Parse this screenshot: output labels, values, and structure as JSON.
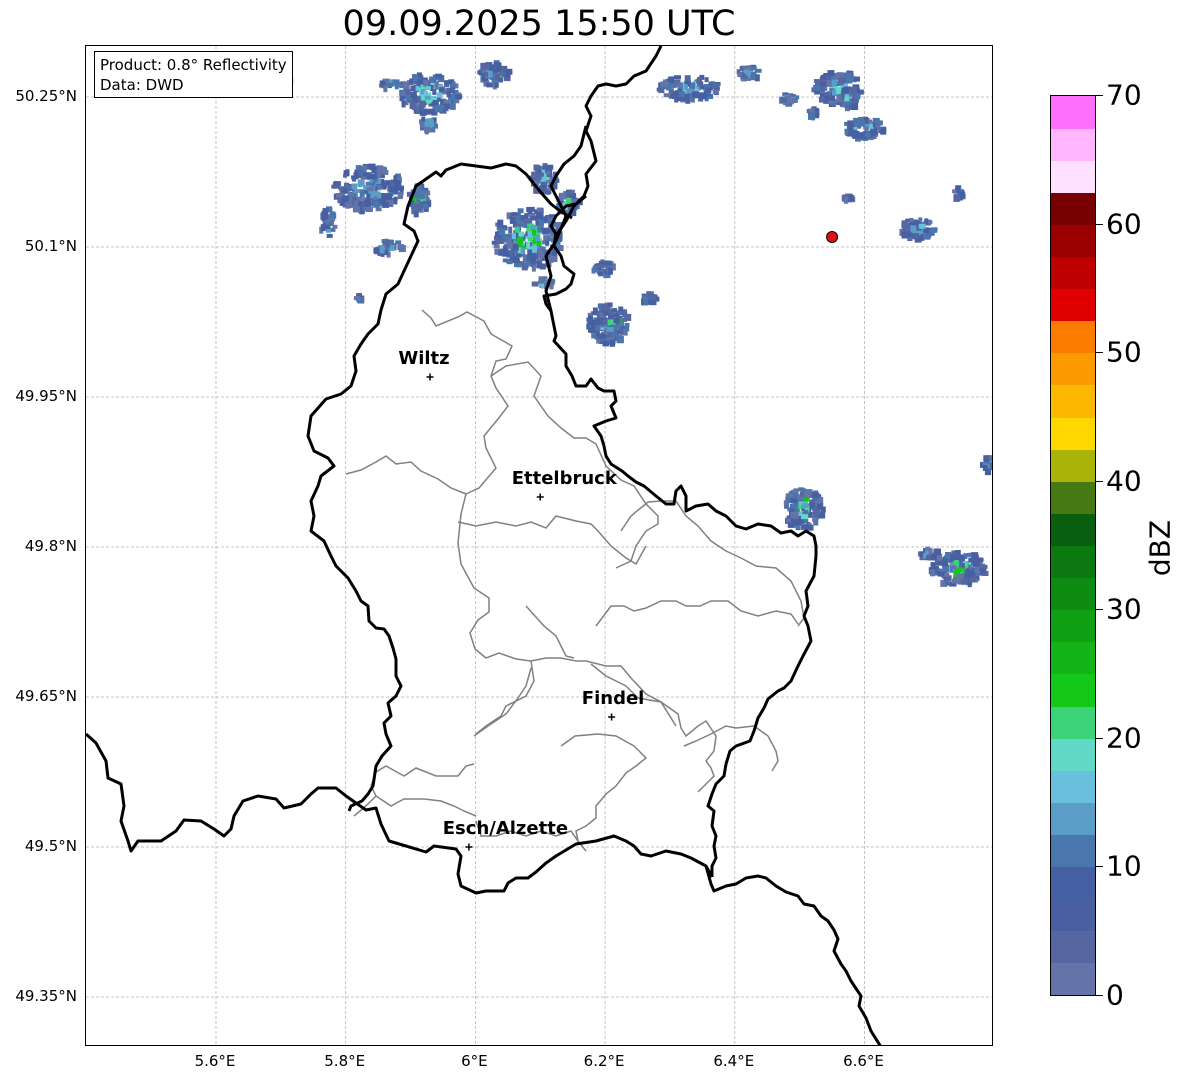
{
  "title": "09.09.2025 15:50 UTC",
  "info": {
    "product": "Product: 0.8° Reflectivity",
    "data_source": "Data: DWD"
  },
  "map": {
    "extent": {
      "lon": [
        5.4,
        6.8
      ],
      "lat": [
        49.3,
        50.3
      ]
    },
    "lat_ticks": [
      "50.25°N",
      "50.1°N",
      "49.95°N",
      "49.8°N",
      "49.65°N",
      "49.5°N",
      "49.35°N"
    ],
    "lon_ticks": [
      "5.6°E",
      "5.8°E",
      "6°E",
      "6.2°E",
      "6.4°E",
      "6.6°E"
    ],
    "gridlines": true,
    "cities": [
      {
        "name": "Wiltz",
        "lon": 5.93,
        "lat": 49.97
      },
      {
        "name": "Ettelbruck",
        "lon": 6.1,
        "lat": 49.85
      },
      {
        "name": "Findel",
        "lon": 6.21,
        "lat": 49.63
      },
      {
        "name": "Esch/Alzette",
        "lon": 5.99,
        "lat": 49.5
      }
    ],
    "radar_site": {
      "lon": 6.55,
      "lat": 50.11,
      "color": "#e01010"
    }
  },
  "colorbar": {
    "label": "dBZ",
    "ticks": [
      "0",
      "10",
      "20",
      "30",
      "40",
      "50",
      "60",
      "70"
    ],
    "range": [
      0,
      70
    ],
    "step": 2.5,
    "colors": [
      "#6574a8",
      "#5566a0",
      "#4a5fa0",
      "#4460a2",
      "#4a76ae",
      "#5a9dc6",
      "#68c0dc",
      "#62d9c6",
      "#3cd278",
      "#14c81a",
      "#12b418",
      "#10a014",
      "#0e8c12",
      "#0c7810",
      "#0a5e10",
      "#467814",
      "#aab408",
      "#fcd700",
      "#fcb800",
      "#fc9a00",
      "#fc7c00",
      "#e00000",
      "#be0000",
      "#9a0000",
      "#780000",
      "#ffe0ff",
      "#ffb6ff",
      "#ff70ff",
      "#ee3cee"
    ]
  },
  "colors": {
    "border": "#000000",
    "cantons": "#808080",
    "grid": "#b4b4b4"
  }
}
